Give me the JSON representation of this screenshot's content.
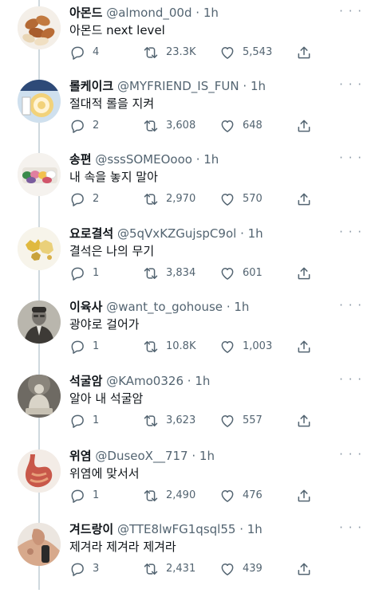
{
  "more_glyph": "· · ·",
  "separator": "·",
  "tweets": [
    {
      "name": "아몬드",
      "handle": "@almond_00d",
      "time": "1h",
      "text": "아몬드 next level",
      "replies": "4",
      "retweets": "23.3K",
      "likes": "5,543",
      "avatar": "almonds"
    },
    {
      "name": "롤케이크",
      "handle": "@MYFRIEND_IS_FUN",
      "time": "1h",
      "text": "절대적 롤을 지켜",
      "replies": "2",
      "retweets": "3,608",
      "likes": "648",
      "avatar": "roll-cake"
    },
    {
      "name": "송편",
      "handle": "@sssSOMEOooo",
      "time": "1h",
      "text": "내 속을 놓지 말아",
      "replies": "2",
      "retweets": "2,970",
      "likes": "570",
      "avatar": "songpyeon"
    },
    {
      "name": "요로결석",
      "handle": "@5qVxKZGujspC9ol",
      "time": "1h",
      "text": "결석은 나의 무기",
      "replies": "1",
      "retweets": "3,834",
      "likes": "601",
      "avatar": "kidney-stones"
    },
    {
      "name": "이육사",
      "handle": "@want_to_gohouse",
      "time": "1h",
      "text": "광야로 걸어가",
      "replies": "1",
      "retweets": "10.8K",
      "likes": "1,003",
      "avatar": "portrait"
    },
    {
      "name": "석굴암",
      "handle": "@KAmo0326",
      "time": "1h",
      "text": "알아 내 석굴암",
      "replies": "1",
      "retweets": "3,623",
      "likes": "557",
      "avatar": "buddha-statue"
    },
    {
      "name": "위염",
      "handle": "@DuseoX__717",
      "time": "1h",
      "text": "위염에 맞서서",
      "replies": "1",
      "retweets": "2,490",
      "likes": "476",
      "avatar": "stomach"
    },
    {
      "name": "겨드랑이",
      "handle": "@TTE8lwFG1qsql55",
      "time": "1h",
      "text": "제겨라 제겨라 제겨라",
      "replies": "3",
      "retweets": "2,431",
      "likes": "439",
      "avatar": "armpit"
    }
  ],
  "colors": {
    "text": "#0f1419",
    "secondary": "#536471",
    "thread_line": "#cfd9de"
  }
}
